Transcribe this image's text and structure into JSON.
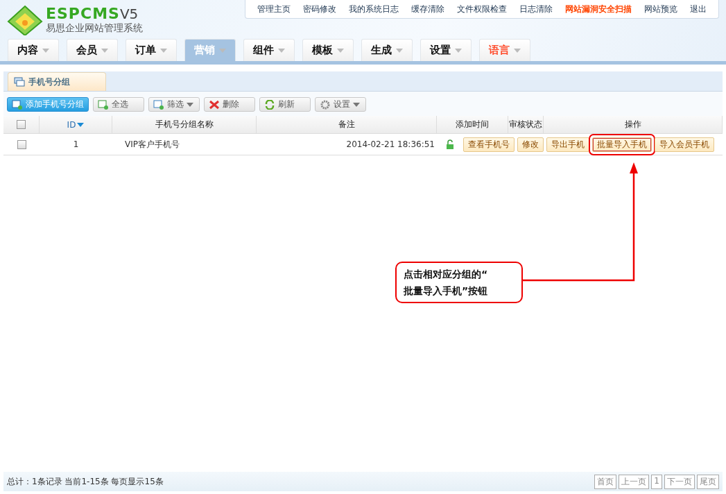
{
  "logo": {
    "brand": "ESPCMS",
    "version": "V5",
    "subtitle": "易思企业网站管理系统"
  },
  "top_links": [
    {
      "label": "管理主页",
      "emphasized": false
    },
    {
      "label": "密码修改",
      "emphasized": false
    },
    {
      "label": "我的系统日志",
      "emphasized": false
    },
    {
      "label": "缓存清除",
      "emphasized": false
    },
    {
      "label": "文件权限检查",
      "emphasized": false
    },
    {
      "label": "日志清除",
      "emphasized": false
    },
    {
      "label": "网站漏洞安全扫描",
      "emphasized": true
    },
    {
      "label": "网站预览",
      "emphasized": false
    },
    {
      "label": "退出",
      "emphasized": false
    }
  ],
  "nav_tabs": [
    {
      "label": "内容",
      "selected": false,
      "emphasized": false
    },
    {
      "label": "会员",
      "selected": false,
      "emphasized": false
    },
    {
      "label": "订单",
      "selected": false,
      "emphasized": false
    },
    {
      "label": "营销",
      "selected": true,
      "emphasized": false
    },
    {
      "label": "组件",
      "selected": false,
      "emphasized": false
    },
    {
      "label": "模板",
      "selected": false,
      "emphasized": false
    },
    {
      "label": "生成",
      "selected": false,
      "emphasized": false
    },
    {
      "label": "设置",
      "selected": false,
      "emphasized": false
    },
    {
      "label": "语言",
      "selected": false,
      "emphasized": true
    }
  ],
  "panel_tab": {
    "label": "手机号分组"
  },
  "toolbar": [
    {
      "kind": "add",
      "label": "添加手机号分组",
      "dropdown": false
    },
    {
      "kind": "select",
      "label": "全选",
      "dropdown": false
    },
    {
      "kind": "filter",
      "label": "筛选",
      "dropdown": true
    },
    {
      "kind": "delete",
      "label": "删除",
      "dropdown": false
    },
    {
      "kind": "refresh",
      "label": "刷新",
      "dropdown": false
    },
    {
      "kind": "settings",
      "label": "设置",
      "dropdown": true
    }
  ],
  "table": {
    "header_checked": false,
    "columns": [
      "ID",
      "手机号分组名称",
      "备注",
      "添加时间",
      "审核状态",
      "操作"
    ],
    "rows": [
      {
        "checked": false,
        "id": "1",
        "name": "VIP客户手机号",
        "time": "2014-02-21 18:36:51",
        "unlocked": true,
        "actions": [
          {
            "label": "查看手机号",
            "highlighted": false
          },
          {
            "label": "修改",
            "highlighted": false
          },
          {
            "label": "导出手机",
            "highlighted": false
          },
          {
            "label": "批量导入手机",
            "highlighted": true
          },
          {
            "label": "导入会员手机",
            "highlighted": false
          }
        ]
      }
    ]
  },
  "callout": {
    "text": "点击相对应分组的“\n批量导入手机”按钮"
  },
  "footer": {
    "summary": "总计：1条记录 当前1-15条 每页显示15条",
    "pager": [
      "首页",
      "上一页",
      "1",
      "下一页",
      "尾页"
    ]
  }
}
